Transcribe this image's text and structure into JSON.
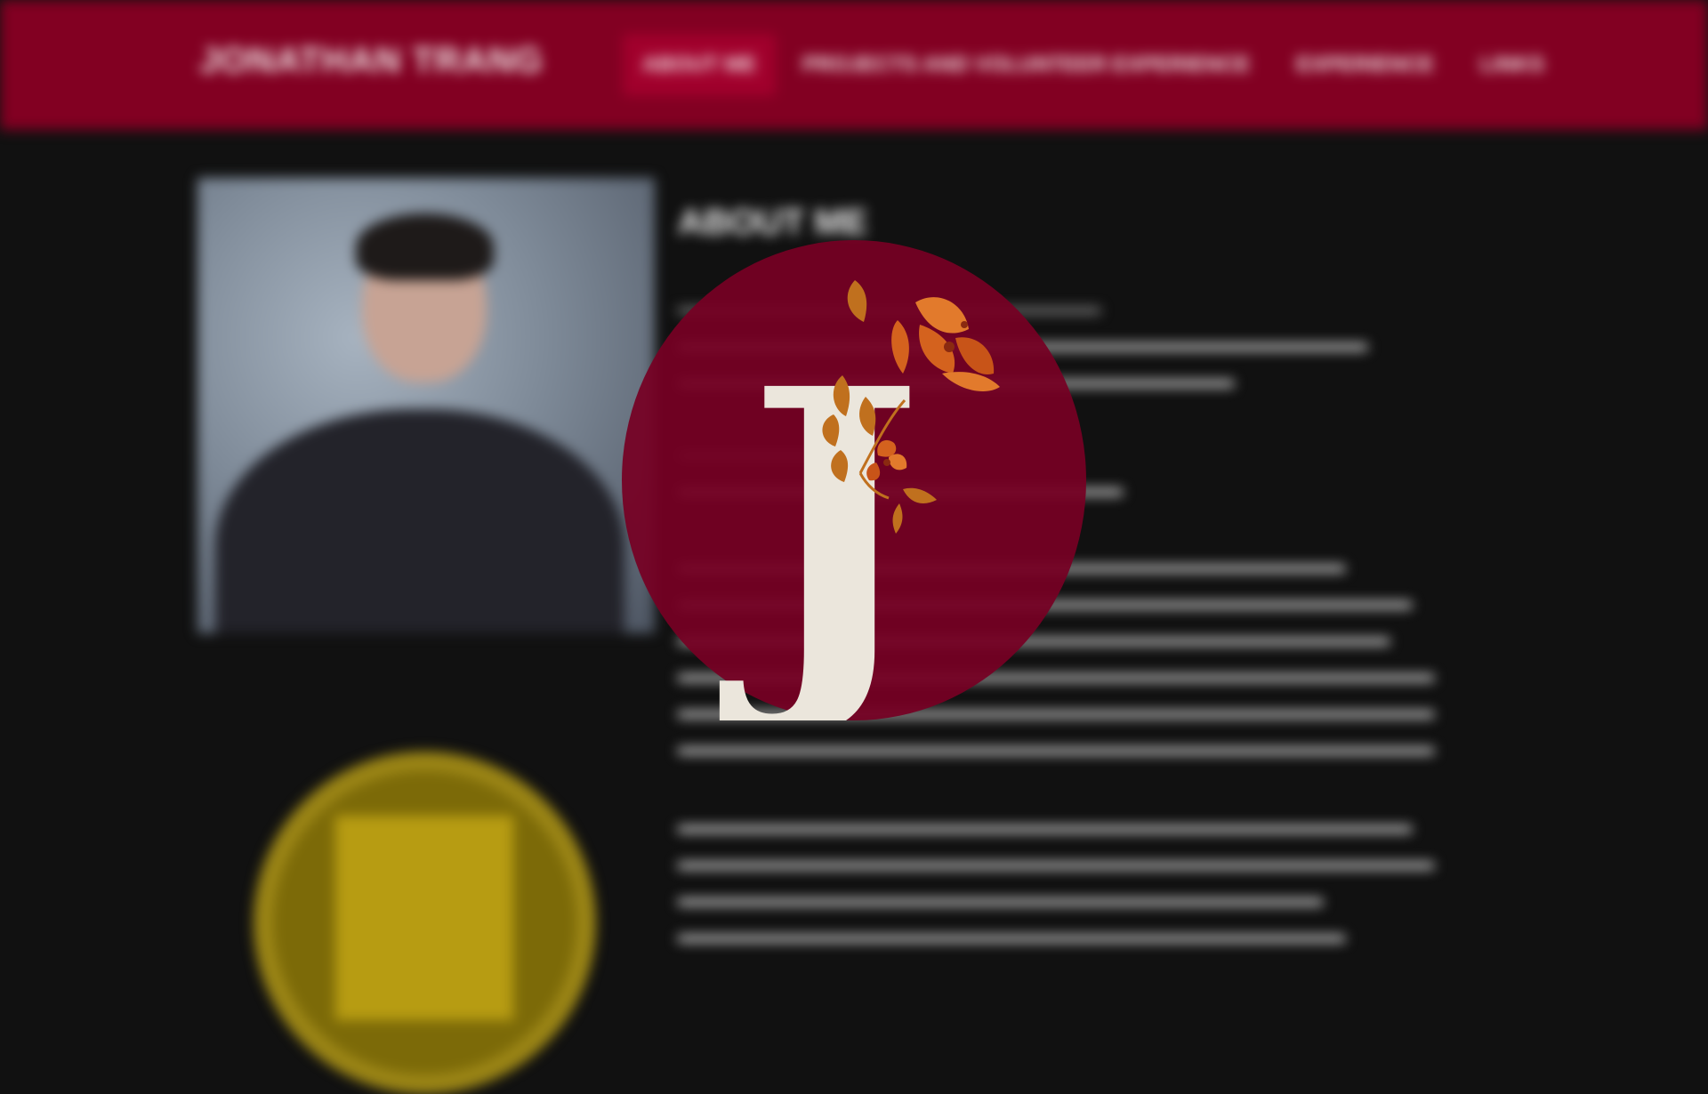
{
  "site": {
    "brand": "JONATHAN TRANG",
    "nav": [
      {
        "label": "ABOUT ME",
        "active": true
      },
      {
        "label": "PROJECTS AND VOLUNTEER EXPERIENCE",
        "active": false
      },
      {
        "label": "EXPERIENCE",
        "active": false
      },
      {
        "label": "LINKS",
        "active": false
      }
    ]
  },
  "about": {
    "heading": "ABOUT ME"
  },
  "loader": {
    "monogram": "J",
    "colors": {
      "circle": "#760023",
      "letter": "#ebe6dc",
      "flower": "#d4621e",
      "leaf": "#c0701e"
    },
    "icon": "monogram-j-floral"
  },
  "colors": {
    "header": "#820022",
    "background": "#111111"
  }
}
